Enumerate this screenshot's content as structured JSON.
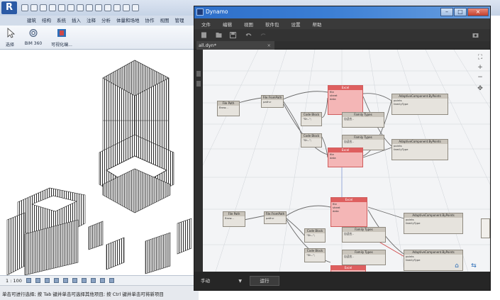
{
  "revit": {
    "tabs": [
      "建筑",
      "结构",
      "系统",
      "插入",
      "注释",
      "分析",
      "体量和场地",
      "协作",
      "视图",
      "管理"
    ],
    "active_tab_index": 0,
    "ribbon_buttons": [
      "选择",
      "BIM 360",
      "可视化编..."
    ],
    "status_scale": "1 : 100",
    "status_hint": "单击可进行选择; 按 Tab 键并单击可选择其他项目; 按 Ctrl 键并单击可将新项目"
  },
  "dynamo": {
    "window_title": "Dynamo",
    "menu": [
      "文件",
      "编辑",
      "视图",
      "软件包",
      "设置",
      "帮助"
    ],
    "tab_name": "all.dyn*",
    "tab_close": "×",
    "run_mode": "手动",
    "run_button": "运行",
    "nodes": {
      "file_path": "File Path",
      "file_from_path": "File.FromPath",
      "code_block": "Code Block",
      "family_types": "Family Types",
      "excel": "Excel",
      "adaptive_by_points": "AdaptiveComponent.ByPoints"
    }
  },
  "colors": {
    "dynamo_title": "#3b7ed4",
    "node_red": "#de5f5f",
    "node_gray": "#c9c4bb"
  }
}
